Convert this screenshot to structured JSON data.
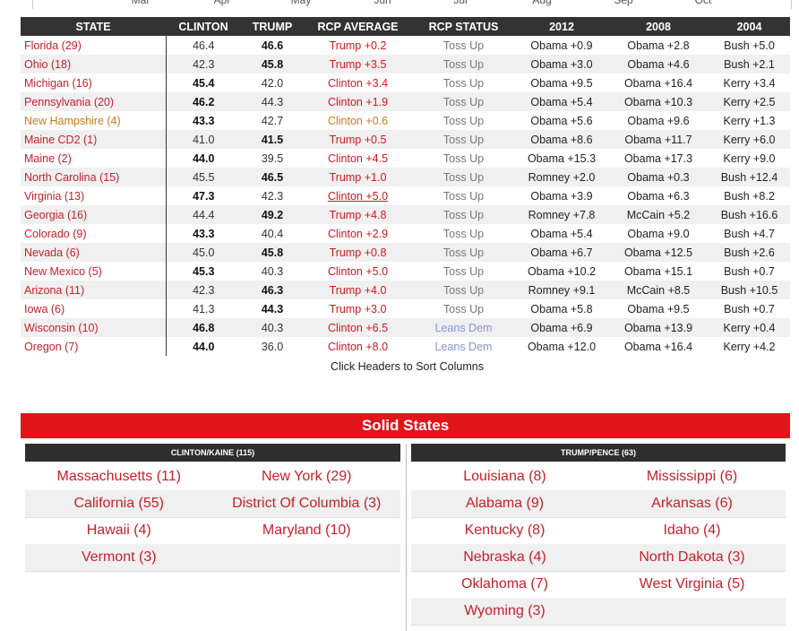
{
  "timeline": {
    "months": [
      "Mar",
      "Apr",
      "May",
      "Jun",
      "Jul",
      "Aug",
      "Sep",
      "Oct"
    ]
  },
  "table": {
    "headers": [
      "STATE",
      "CLINTON",
      "TRUMP",
      "RCP AVERAGE",
      "RCP STATUS",
      "2012",
      "2008",
      "2004"
    ],
    "rows": [
      {
        "state": "Florida (29)",
        "clinton": "46.4",
        "trump": "46.6",
        "avg": "Trump +0.2",
        "status": "Toss Up",
        "y2012": "Obama +0.9",
        "y2008": "Obama +2.8",
        "y2004": "Bush +5.0"
      },
      {
        "state": "Ohio (18)",
        "clinton": "42.3",
        "trump": "45.8",
        "avg": "Trump +3.5",
        "status": "Toss Up",
        "y2012": "Obama +3.0",
        "y2008": "Obama +4.6",
        "y2004": "Bush +2.1"
      },
      {
        "state": "Michigan (16)",
        "clinton": "45.4",
        "trump": "42.0",
        "avg": "Clinton +3.4",
        "status": "Toss Up",
        "y2012": "Obama +9.5",
        "y2008": "Obama +16.4",
        "y2004": "Kerry +3.4"
      },
      {
        "state": "Pennsylvania (20)",
        "clinton": "46.2",
        "trump": "44.3",
        "avg": "Clinton +1.9",
        "status": "Toss Up",
        "y2012": "Obama +5.4",
        "y2008": "Obama +10.3",
        "y2004": "Kerry +2.5"
      },
      {
        "state": "New Hampshire (4)",
        "clinton": "43.3",
        "trump": "42.7",
        "avg": "Clinton +0.6",
        "status": "Toss Up",
        "y2012": "Obama +5.6",
        "y2008": "Obama +9.6",
        "y2004": "Kerry +1.3"
      },
      {
        "state": "Maine CD2 (1)",
        "clinton": "41.0",
        "trump": "41.5",
        "avg": "Trump +0.5",
        "status": "Toss Up",
        "y2012": "Obama +8.6",
        "y2008": "Obama +11.7",
        "y2004": "Kerry +6.0"
      },
      {
        "state": "Maine (2)",
        "clinton": "44.0",
        "trump": "39.5",
        "avg": "Clinton +4.5",
        "status": "Toss Up",
        "y2012": "Obama +15.3",
        "y2008": "Obama +17.3",
        "y2004": "Kerry +9.0"
      },
      {
        "state": "North Carolina (15)",
        "clinton": "45.5",
        "trump": "46.5",
        "avg": "Trump +1.0",
        "status": "Toss Up",
        "y2012": "Romney +2.0",
        "y2008": "Obama +0.3",
        "y2004": "Bush +12.4"
      },
      {
        "state": "Virginia (13)",
        "clinton": "47.3",
        "trump": "42.3",
        "avg": "Clinton +5.0",
        "status": "Toss Up",
        "y2012": "Obama +3.9",
        "y2008": "Obama +6.3",
        "y2004": "Bush +8.2"
      },
      {
        "state": "Georgia (16)",
        "clinton": "44.4",
        "trump": "49.2",
        "avg": "Trump +4.8",
        "status": "Toss Up",
        "y2012": "Romney +7.8",
        "y2008": "McCain +5.2",
        "y2004": "Bush +16.6"
      },
      {
        "state": "Colorado (9)",
        "clinton": "43.3",
        "trump": "40.4",
        "avg": "Clinton +2.9",
        "status": "Toss Up",
        "y2012": "Obama +5.4",
        "y2008": "Obama +9.0",
        "y2004": "Bush +4.7"
      },
      {
        "state": "Nevada (6)",
        "clinton": "45.0",
        "trump": "45.8",
        "avg": "Trump +0.8",
        "status": "Toss Up",
        "y2012": "Obama +6.7",
        "y2008": "Obama +12.5",
        "y2004": "Bush +2.6"
      },
      {
        "state": "New Mexico (5)",
        "clinton": "45.3",
        "trump": "40.3",
        "avg": "Clinton +5.0",
        "status": "Toss Up",
        "y2012": "Obama +10.2",
        "y2008": "Obama +15.1",
        "y2004": "Bush +0.7"
      },
      {
        "state": "Arizona (11)",
        "clinton": "42.3",
        "trump": "46.3",
        "avg": "Trump +4.0",
        "status": "Toss Up",
        "y2012": "Romney +9.1",
        "y2008": "McCain +8.5",
        "y2004": "Bush +10.5"
      },
      {
        "state": "Iowa (6)",
        "clinton": "41.3",
        "trump": "44.3",
        "avg": "Trump +3.0",
        "status": "Toss Up",
        "y2012": "Obama +5.8",
        "y2008": "Obama +9.5",
        "y2004": "Bush +0.7"
      },
      {
        "state": "Wisconsin (10)",
        "clinton": "46.8",
        "trump": "40.3",
        "avg": "Clinton +6.5",
        "status": "Leans Dem",
        "y2012": "Obama +6.9",
        "y2008": "Obama +13.9",
        "y2004": "Kerry +0.4"
      },
      {
        "state": "Oregon (7)",
        "clinton": "44.0",
        "trump": "36.0",
        "avg": "Clinton +8.0",
        "status": "Leans Dem",
        "y2012": "Obama +12.0",
        "y2008": "Obama +16.4",
        "y2004": "Kerry +4.2"
      }
    ],
    "sort_note": "Click Headers to Sort Columns"
  },
  "solid": {
    "title": "Solid States",
    "clinton_header": "CLINTON/KAINE (115)",
    "trump_header": "TRUMP/PENCE (63)",
    "clinton_states": [
      "Massachusetts (11)",
      "New York (29)",
      "California (55)",
      "District Of Columbia (3)",
      "Hawaii (4)",
      "Maryland (10)",
      "Vermont (3)"
    ],
    "trump_states": [
      "Louisiana (8)",
      "Mississippi (6)",
      "Alabama (9)",
      "Arkansas (6)",
      "Kentucky (8)",
      "Idaho (4)",
      "Nebraska (4)",
      "North Dakota (3)",
      "Oklahoma (7)",
      "West Virginia (5)",
      "Wyoming (3)"
    ]
  },
  "colors": {
    "red": "#c8202a",
    "header": "#333333",
    "solid_bar": "#e2151b",
    "lean": "#8a94d8",
    "orange": "#c97a1a"
  }
}
